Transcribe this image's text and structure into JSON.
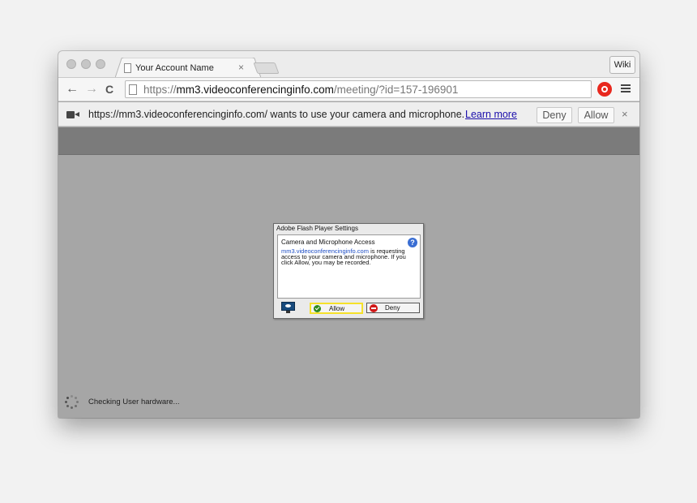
{
  "window": {
    "tab": {
      "title": "Your Account Name",
      "close_glyph": "×",
      "icon": "document-icon"
    },
    "wiki_button": "Wiki"
  },
  "toolbar": {
    "back_glyph": "←",
    "forward_glyph": "→",
    "reload_glyph": "C",
    "url_prefix": "https://",
    "url_host": "mm3.videoconferencinginfo.com",
    "url_path": "/meeting/?id=157-196901",
    "extension_icon": "stop-icon",
    "menu_icon": "hamburger-icon"
  },
  "infobar": {
    "icon": "camera-icon",
    "message": "https://mm3.videoconferencinginfo.com/ wants to use your camera and microphone.",
    "learn_more": "Learn more",
    "deny": "Deny",
    "allow": "Allow",
    "close_glyph": "×"
  },
  "flash_dialog": {
    "title": "Adobe Flash Player Settings",
    "heading": "Camera and Microphone Access",
    "help_glyph": "?",
    "body_domain": "mm3.videoconferencinginfo.com",
    "body_text": " is requesting access to your camera and microphone. If you click Allow, you may be recorded.",
    "allow": "Allow",
    "deny": "Deny"
  },
  "status": {
    "text": "Checking User hardware...",
    "icon": "loading-spinner-icon"
  },
  "colors": {
    "page_background": "#a6a6a6",
    "header_bar": "#7b7b7b",
    "link": "#1a0dab",
    "allow_highlight": "#f5e12a"
  }
}
